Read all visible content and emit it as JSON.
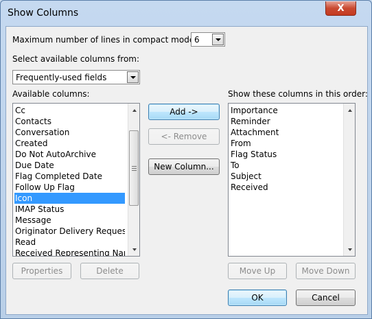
{
  "window": {
    "title": "Show Columns",
    "close_label": "X"
  },
  "compact_mode": {
    "label": "Maximum number of lines in compact mode:",
    "value": "6"
  },
  "select_from": {
    "label": "Select available columns from:",
    "value": "Frequently-used fields"
  },
  "available": {
    "label": "Available columns:",
    "items": [
      "Cc",
      "Contacts",
      "Conversation",
      "Created",
      "Do Not AutoArchive",
      "Due Date",
      "Flag Completed Date",
      "Follow Up Flag",
      "Icon",
      "IMAP Status",
      "Message",
      "Originator Delivery Requested",
      "Read",
      "Received Representing Name"
    ],
    "selected_index": 8
  },
  "shown": {
    "label": "Show these columns in this order:",
    "items": [
      "Importance",
      "Reminder",
      "Attachment",
      "From",
      "Flag Status",
      "To",
      "Subject",
      "Received"
    ]
  },
  "buttons": {
    "add": "Add ->",
    "remove": "<- Remove",
    "new_column": "New Column...",
    "properties": "Properties",
    "delete": "Delete",
    "move_up": "Move Up",
    "move_down": "Move Down",
    "ok": "OK",
    "cancel": "Cancel"
  }
}
